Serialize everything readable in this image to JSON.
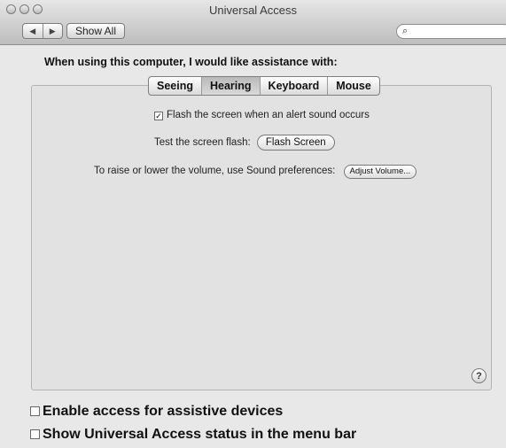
{
  "window": {
    "title": "Universal Access",
    "nav": {
      "back_icon": "back-arrow-icon",
      "forward_icon": "forward-arrow-icon",
      "show_all_label": "Show All"
    },
    "search": {
      "placeholder": "",
      "icon": "search-icon"
    }
  },
  "prompt": "When using this computer, I would like assistance with:",
  "tabs": [
    {
      "label": "Seeing",
      "selected": false
    },
    {
      "label": "Hearing",
      "selected": true
    },
    {
      "label": "Keyboard",
      "selected": false
    },
    {
      "label": "Mouse",
      "selected": false
    }
  ],
  "hearing": {
    "flash_checkbox": {
      "label": "Flash the screen when an alert sound occurs",
      "checked": true
    },
    "test_flash_label": "Test the screen flash:",
    "flash_button": "Flash Screen",
    "volume_label": "To raise or lower the volume, use Sound preferences:",
    "adjust_volume_button": "Adjust Volume..."
  },
  "help_label": "?",
  "bottom": {
    "assistive": {
      "label": "Enable access for assistive devices",
      "checked": false
    },
    "menubar": {
      "label": "Show Universal Access status in the menu bar",
      "checked": false
    }
  },
  "colors": {
    "accent_overlay": "#17bcd6"
  }
}
